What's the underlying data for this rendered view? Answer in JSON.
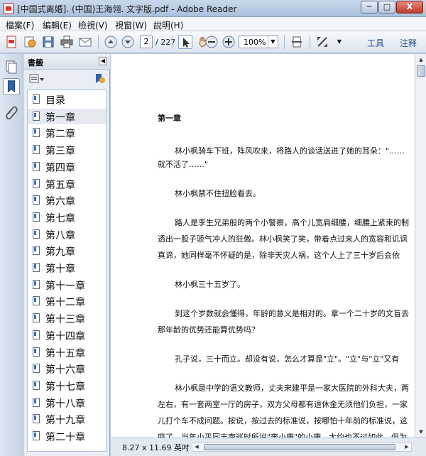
{
  "window": {
    "title": "[中国式离婚]. (中国)王海翎. 文字版.pdf - Adobe Reader",
    "min_label": "─",
    "max_label": "□",
    "close_label": "X"
  },
  "menu": {
    "items": [
      {
        "label": "檔案(F)"
      },
      {
        "label": "編輯(E)"
      },
      {
        "label": "檢視(V)"
      },
      {
        "label": "視窗(W)"
      },
      {
        "label": "說明(H)"
      }
    ]
  },
  "toolbar": {
    "current_page": "2",
    "total_pages": "/ 227",
    "zoom": "100%",
    "tools_label": "工具",
    "comment_label": "注释"
  },
  "bookmarks": {
    "title": "書籤",
    "items": [
      {
        "label": "目录"
      },
      {
        "label": "第一章"
      },
      {
        "label": "第二章"
      },
      {
        "label": "第三章"
      },
      {
        "label": "第四章"
      },
      {
        "label": "第五章"
      },
      {
        "label": "第六章"
      },
      {
        "label": "第七章"
      },
      {
        "label": "第八章"
      },
      {
        "label": "第九章"
      },
      {
        "label": "第十章"
      },
      {
        "label": "第十一章"
      },
      {
        "label": "第十二章"
      },
      {
        "label": "第十三章"
      },
      {
        "label": "第十四章"
      },
      {
        "label": "第十五章"
      },
      {
        "label": "第十六章"
      },
      {
        "label": "第十七章"
      },
      {
        "label": "第十八章"
      },
      {
        "label": "第十九章"
      },
      {
        "label": "第二十章"
      }
    ],
    "selected_index": 1
  },
  "document": {
    "heading": "第一章",
    "lines": [
      "林小枫骑车下班，阵风吹来，将路人的谈话送进了她的耳朵：\"……",
      "就不活了……\"",
      "林小枫禁不住扭脸看去。",
      "路人是孪生兄弟般的两个小警察，高个儿宽肩细腰，细腰上紧束的制",
      "透出一股子骄气冲人的狂傲。林小枫笑了笑，带着点过来人的宽容和讥讽",
      "真谛，她同样毫不怀疑的是，除非天灾人祸，这个人上了三十岁后会依",
      "林小枫三十五岁了。",
      "到这个岁数就会懂得，年龄的意义是相对的。拿一个二十岁的文盲去",
      "那年龄的优势还能算优势吗？",
      "孔子说，三十而立。却没有说，怎么才算是\"立\"。\"立\"与\"立\"又有",
      "林小枫是中学的语文教师，丈夫宋建平是一家大医院的外科大夫，两",
      "左右，有一套两室一厅的房子，双方父母都有退休金无须他们负担，一家",
      "儿打个车不成问题。按说，按过去的标准说，按哪怕十年前的标准说，这",
      "庭了。当年小平同志南巡时所说\"奔小康\"的小康，大约也不过如此。但为"
    ]
  },
  "status": {
    "page_size": "8.27 x 11.69 英吋"
  }
}
